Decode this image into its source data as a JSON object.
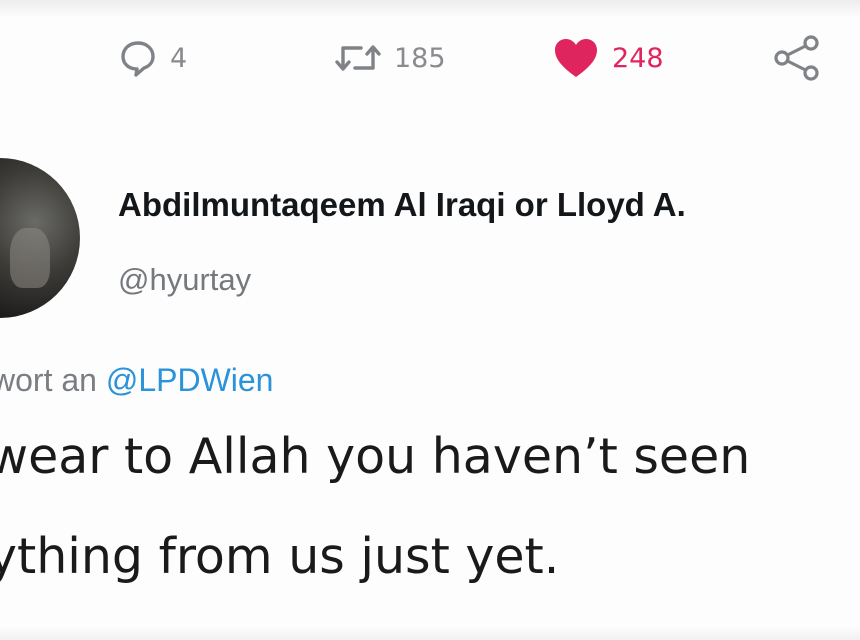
{
  "actions": {
    "reply_count": "4",
    "retweet_count": "185",
    "like_count": "248",
    "icons": {
      "reply": "speech-bubble-icon",
      "retweet": "retweet-arrows-icon",
      "like": "heart-icon",
      "share": "share-nodes-icon"
    },
    "like_color": "#e0245e"
  },
  "author": {
    "display_name": "Abdilmuntaqeem Al Iraqi or Lloyd A.",
    "handle": "@hyurtay"
  },
  "reply_to": {
    "prefix": "wort an ",
    "mention": "@LPDWien",
    "mention_color": "#2a93d9"
  },
  "tweet": {
    "line1": "wear to Allah you haven’t seen",
    "line2": "ything from us just yet."
  }
}
